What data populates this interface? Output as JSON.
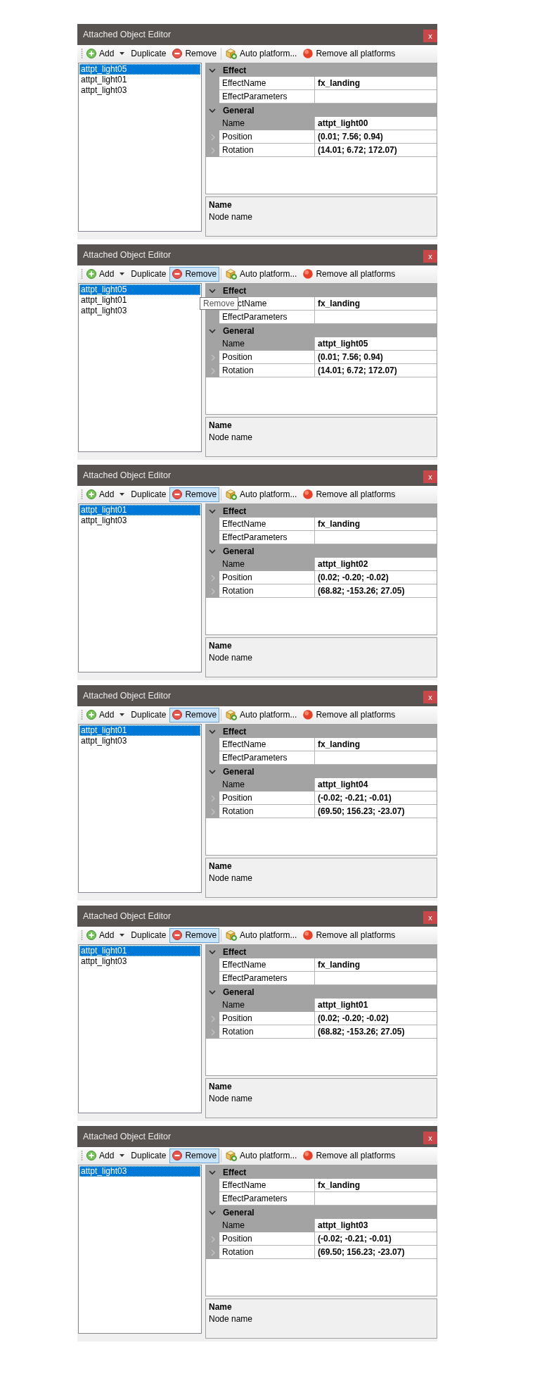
{
  "panels": [
    {
      "title": "Attached Object Editor",
      "close": "x",
      "toolbar": [
        {
          "kind": "add",
          "label": "Add",
          "dropdown": true,
          "highlighted": false,
          "separator_before": false
        },
        {
          "kind": "text",
          "label": "Duplicate",
          "dropdown": false,
          "highlighted": false,
          "separator_before": false
        },
        {
          "kind": "remove",
          "label": "Remove",
          "dropdown": false,
          "highlighted": false,
          "separator_before": false
        },
        {
          "kind": "box",
          "label": "Auto platform...",
          "dropdown": false,
          "highlighted": false,
          "separator_before": true
        },
        {
          "kind": "sphere",
          "label": "Remove all platforms",
          "dropdown": false,
          "highlighted": false,
          "separator_before": false
        }
      ],
      "objects": [
        {
          "label": "attpt_light05",
          "selected": true
        },
        {
          "label": "attpt_light01",
          "selected": false
        },
        {
          "label": "attpt_light03",
          "selected": false
        }
      ],
      "grid": [
        {
          "name": "Effect",
          "expanded": true,
          "rows": [
            {
              "name": "EffectName",
              "value": "fx_landing",
              "selected": false,
              "expandable": false
            },
            {
              "name": "EffectParameters",
              "selected": false,
              "expandable": false
            }
          ]
        },
        {
          "name": "General",
          "expanded": true,
          "rows": [
            {
              "name": "Name",
              "value": "attpt_light00",
              "selected": true,
              "expandable": false
            },
            {
              "name": "Position",
              "value": "(0.01; 7.56; 0.94)",
              "selected": false,
              "expandable": true
            },
            {
              "name": "Rotation",
              "value": "(14.01; 6.72; 172.07)",
              "selected": false,
              "expandable": true
            }
          ]
        }
      ],
      "description": {
        "title": "Name",
        "text": "Node name"
      }
    },
    {
      "title": "Attached Object Editor",
      "close": "x",
      "toolbar": [
        {
          "kind": "add",
          "label": "Add",
          "dropdown": true,
          "highlighted": false,
          "separator_before": false
        },
        {
          "kind": "text",
          "label": "Duplicate",
          "dropdown": false,
          "highlighted": false,
          "separator_before": false
        },
        {
          "kind": "remove",
          "label": "Remove",
          "dropdown": false,
          "highlighted": true,
          "separator_before": false
        },
        {
          "kind": "box",
          "label": "Auto platform...",
          "dropdown": false,
          "highlighted": false,
          "separator_before": true
        },
        {
          "kind": "sphere",
          "label": "Remove all platforms",
          "dropdown": false,
          "highlighted": false,
          "separator_before": false
        }
      ],
      "tooltip": {
        "text": "Remove"
      },
      "objects": [
        {
          "label": "attpt_light05",
          "selected": true
        },
        {
          "label": "attpt_light01",
          "selected": false
        },
        {
          "label": "attpt_light03",
          "selected": false
        }
      ],
      "grid": [
        {
          "name": "Effect",
          "expanded": true,
          "rows": [
            {
              "name": "ctName",
              "value": "fx_landing",
              "selected": false,
              "expandable": false
            },
            {
              "name": "EffectParameters",
              "selected": false,
              "expandable": false
            }
          ]
        },
        {
          "name": "General",
          "expanded": true,
          "rows": [
            {
              "name": "Name",
              "value": "attpt_light05",
              "selected": true,
              "expandable": false
            },
            {
              "name": "Position",
              "value": "(0.01; 7.56; 0.94)",
              "selected": false,
              "expandable": true
            },
            {
              "name": "Rotation",
              "value": "(14.01; 6.72; 172.07)",
              "selected": false,
              "expandable": true
            }
          ]
        }
      ],
      "description": {
        "title": "Name",
        "text": "Node name"
      }
    },
    {
      "title": "Attached Object Editor",
      "close": "x",
      "toolbar": [
        {
          "kind": "add",
          "label": "Add",
          "dropdown": true,
          "highlighted": false,
          "separator_before": false
        },
        {
          "kind": "text",
          "label": "Duplicate",
          "dropdown": false,
          "highlighted": false,
          "separator_before": false
        },
        {
          "kind": "remove",
          "label": "Remove",
          "dropdown": false,
          "highlighted": true,
          "separator_before": false
        },
        {
          "kind": "box",
          "label": "Auto platform...",
          "dropdown": false,
          "highlighted": false,
          "separator_before": true
        },
        {
          "kind": "sphere",
          "label": "Remove all platforms",
          "dropdown": false,
          "highlighted": false,
          "separator_before": false
        }
      ],
      "objects": [
        {
          "label": "attpt_light01",
          "selected": true
        },
        {
          "label": "attpt_light03",
          "selected": false
        }
      ],
      "grid": [
        {
          "name": "Effect",
          "expanded": true,
          "rows": [
            {
              "name": "EffectName",
              "value": "fx_landing",
              "selected": false,
              "expandable": false
            },
            {
              "name": "EffectParameters",
              "selected": false,
              "expandable": false
            }
          ]
        },
        {
          "name": "General",
          "expanded": true,
          "rows": [
            {
              "name": "Name",
              "value": "attpt_light02",
              "selected": true,
              "expandable": false
            },
            {
              "name": "Position",
              "value": "(0.02; -0.20; -0.02)",
              "selected": false,
              "expandable": true
            },
            {
              "name": "Rotation",
              "value": "(68.82; -153.26; 27.05)",
              "selected": false,
              "expandable": true
            }
          ]
        }
      ],
      "description": {
        "title": "Name",
        "text": "Node name"
      }
    },
    {
      "title": "Attached Object Editor",
      "close": "x",
      "toolbar": [
        {
          "kind": "add",
          "label": "Add",
          "dropdown": true,
          "highlighted": false,
          "separator_before": false
        },
        {
          "kind": "text",
          "label": "Duplicate",
          "dropdown": false,
          "highlighted": false,
          "separator_before": false
        },
        {
          "kind": "remove",
          "label": "Remove",
          "dropdown": false,
          "highlighted": true,
          "separator_before": false
        },
        {
          "kind": "box",
          "label": "Auto platform...",
          "dropdown": false,
          "highlighted": false,
          "separator_before": true
        },
        {
          "kind": "sphere",
          "label": "Remove all platforms",
          "dropdown": false,
          "highlighted": false,
          "separator_before": false
        }
      ],
      "objects": [
        {
          "label": "attpt_light01",
          "selected": true
        },
        {
          "label": "attpt_light03",
          "selected": false
        }
      ],
      "grid": [
        {
          "name": "Effect",
          "expanded": true,
          "rows": [
            {
              "name": "EffectName",
              "value": "fx_landing",
              "selected": false,
              "expandable": false
            },
            {
              "name": "EffectParameters",
              "selected": false,
              "expandable": false
            }
          ]
        },
        {
          "name": "General",
          "expanded": true,
          "rows": [
            {
              "name": "Name",
              "value": "attpt_light04",
              "selected": true,
              "expandable": false
            },
            {
              "name": "Position",
              "value": "(-0.02; -0.21; -0.01)",
              "selected": false,
              "expandable": true
            },
            {
              "name": "Rotation",
              "value": "(69.50; 156.23; -23.07)",
              "selected": false,
              "expandable": true
            }
          ]
        }
      ],
      "description": {
        "title": "Name",
        "text": "Node name"
      }
    },
    {
      "title": "Attached Object Editor",
      "close": "x",
      "toolbar": [
        {
          "kind": "add",
          "label": "Add",
          "dropdown": true,
          "highlighted": false,
          "separator_before": false
        },
        {
          "kind": "text",
          "label": "Duplicate",
          "dropdown": false,
          "highlighted": false,
          "separator_before": false
        },
        {
          "kind": "remove",
          "label": "Remove",
          "dropdown": false,
          "highlighted": true,
          "separator_before": false
        },
        {
          "kind": "box",
          "label": "Auto platform...",
          "dropdown": false,
          "highlighted": false,
          "separator_before": true
        },
        {
          "kind": "sphere",
          "label": "Remove all platforms",
          "dropdown": false,
          "highlighted": false,
          "separator_before": false
        }
      ],
      "objects": [
        {
          "label": "attpt_light01",
          "selected": true
        },
        {
          "label": "attpt_light03",
          "selected": false
        }
      ],
      "grid": [
        {
          "name": "Effect",
          "expanded": true,
          "rows": [
            {
              "name": "EffectName",
              "value": "fx_landing",
              "selected": false,
              "expandable": false
            },
            {
              "name": "EffectParameters",
              "selected": false,
              "expandable": false
            }
          ]
        },
        {
          "name": "General",
          "expanded": true,
          "rows": [
            {
              "name": "Name",
              "value": "attpt_light01",
              "selected": true,
              "expandable": false
            },
            {
              "name": "Position",
              "value": "(0.02; -0.20; -0.02)",
              "selected": false,
              "expandable": true
            },
            {
              "name": "Rotation",
              "value": "(68.82; -153.26; 27.05)",
              "selected": false,
              "expandable": true
            }
          ]
        }
      ],
      "description": {
        "title": "Name",
        "text": "Node name"
      }
    },
    {
      "title": "Attached Object Editor",
      "close": "x",
      "toolbar": [
        {
          "kind": "add",
          "label": "Add",
          "dropdown": true,
          "highlighted": false,
          "separator_before": false
        },
        {
          "kind": "text",
          "label": "Duplicate",
          "dropdown": false,
          "highlighted": false,
          "separator_before": false
        },
        {
          "kind": "remove",
          "label": "Remove",
          "dropdown": false,
          "highlighted": true,
          "separator_before": false
        },
        {
          "kind": "box",
          "label": "Auto platform...",
          "dropdown": false,
          "highlighted": false,
          "separator_before": true
        },
        {
          "kind": "sphere",
          "label": "Remove all platforms",
          "dropdown": false,
          "highlighted": false,
          "separator_before": false
        }
      ],
      "objects": [
        {
          "label": "attpt_light03",
          "selected": true
        }
      ],
      "grid": [
        {
          "name": "Effect",
          "expanded": true,
          "rows": [
            {
              "name": "EffectName",
              "value": "fx_landing",
              "selected": false,
              "expandable": false
            },
            {
              "name": "EffectParameters",
              "selected": false,
              "expandable": false
            }
          ]
        },
        {
          "name": "General",
          "expanded": true,
          "rows": [
            {
              "name": "Name",
              "value": "attpt_light03",
              "selected": true,
              "expandable": false
            },
            {
              "name": "Position",
              "value": "(-0.02; -0.21; -0.01)",
              "selected": false,
              "expandable": true
            },
            {
              "name": "Rotation",
              "value": "(69.50; 156.23; -23.07)",
              "selected": false,
              "expandable": true
            }
          ]
        }
      ],
      "description": {
        "title": "Name",
        "text": "Node name"
      }
    }
  ]
}
